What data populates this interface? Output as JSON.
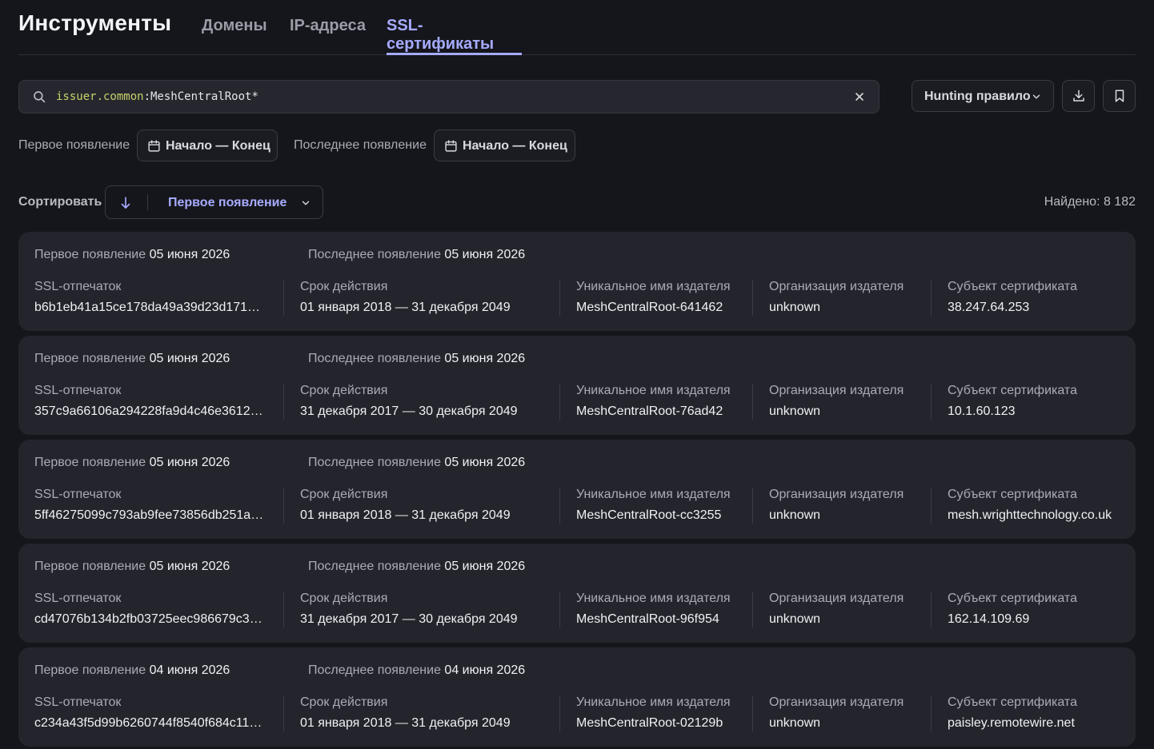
{
  "header": {
    "title": "Инструменты",
    "tabs": [
      {
        "label": "Домены"
      },
      {
        "label": "IP-адреса"
      },
      {
        "label": "SSL-сертификаты"
      }
    ]
  },
  "search": {
    "key": "issuer.common",
    "value": ":MeshCentralRoot*"
  },
  "toolbar": {
    "hunting_label": "Hunting правило"
  },
  "filters": {
    "first_seen_label": "Первое появление",
    "first_seen_value": "Начало — Конец",
    "last_seen_label": "Последнее появление",
    "last_seen_value": "Начало — Конец"
  },
  "sort": {
    "label": "Сортировать",
    "field": "Первое появление",
    "found": "Найдено: 8 182"
  },
  "card_labels": {
    "first_seen": "Первое появление",
    "last_seen": "Последнее появление",
    "fingerprint": "SSL-отпечаток",
    "validity": "Срок действия",
    "issuer_cn": "Уникальное имя издателя",
    "issuer_org": "Организация издателя",
    "subject": "Субъект сертификата"
  },
  "results": [
    {
      "first_seen": "05 июня 2026",
      "last_seen": "05 июня 2026",
      "fingerprint": "b6b1eb41a15ce178da49a39d23d171…",
      "validity": "01 января 2018 — 31 декабря 2049",
      "issuer_cn": "MeshCentralRoot-641462",
      "issuer_org": "unknown",
      "subject": "38.247.64.253"
    },
    {
      "first_seen": "05 июня 2026",
      "last_seen": "05 июня 2026",
      "fingerprint": "357c9a66106a294228fa9d4c46e3612…",
      "validity": "31 декабря 2017 — 30 декабря 2049",
      "issuer_cn": "MeshCentralRoot-76ad42",
      "issuer_org": "unknown",
      "subject": "10.1.60.123"
    },
    {
      "first_seen": "05 июня 2026",
      "last_seen": "05 июня 2026",
      "fingerprint": "5ff46275099c793ab9fee73856db251a…",
      "validity": "01 января 2018 — 31 декабря 2049",
      "issuer_cn": "MeshCentralRoot-cc3255",
      "issuer_org": "unknown",
      "subject": "mesh.wrighttechnology.co.uk"
    },
    {
      "first_seen": "05 июня 2026",
      "last_seen": "05 июня 2026",
      "fingerprint": "cd47076b134b2fb03725eec986679c3…",
      "validity": "31 декабря 2017 — 30 декабря 2049",
      "issuer_cn": "MeshCentralRoot-96f954",
      "issuer_org": "unknown",
      "subject": "162.14.109.69"
    },
    {
      "first_seen": "04 июня 2026",
      "last_seen": "04 июня 2026",
      "fingerprint": "c234a43f5d99b6260744f8540f684c11…",
      "validity": "01 января 2018 — 31 декабря 2049",
      "issuer_cn": "MeshCentralRoot-02129b",
      "issuer_org": "unknown",
      "subject": "paisley.remotewire.net"
    }
  ]
}
